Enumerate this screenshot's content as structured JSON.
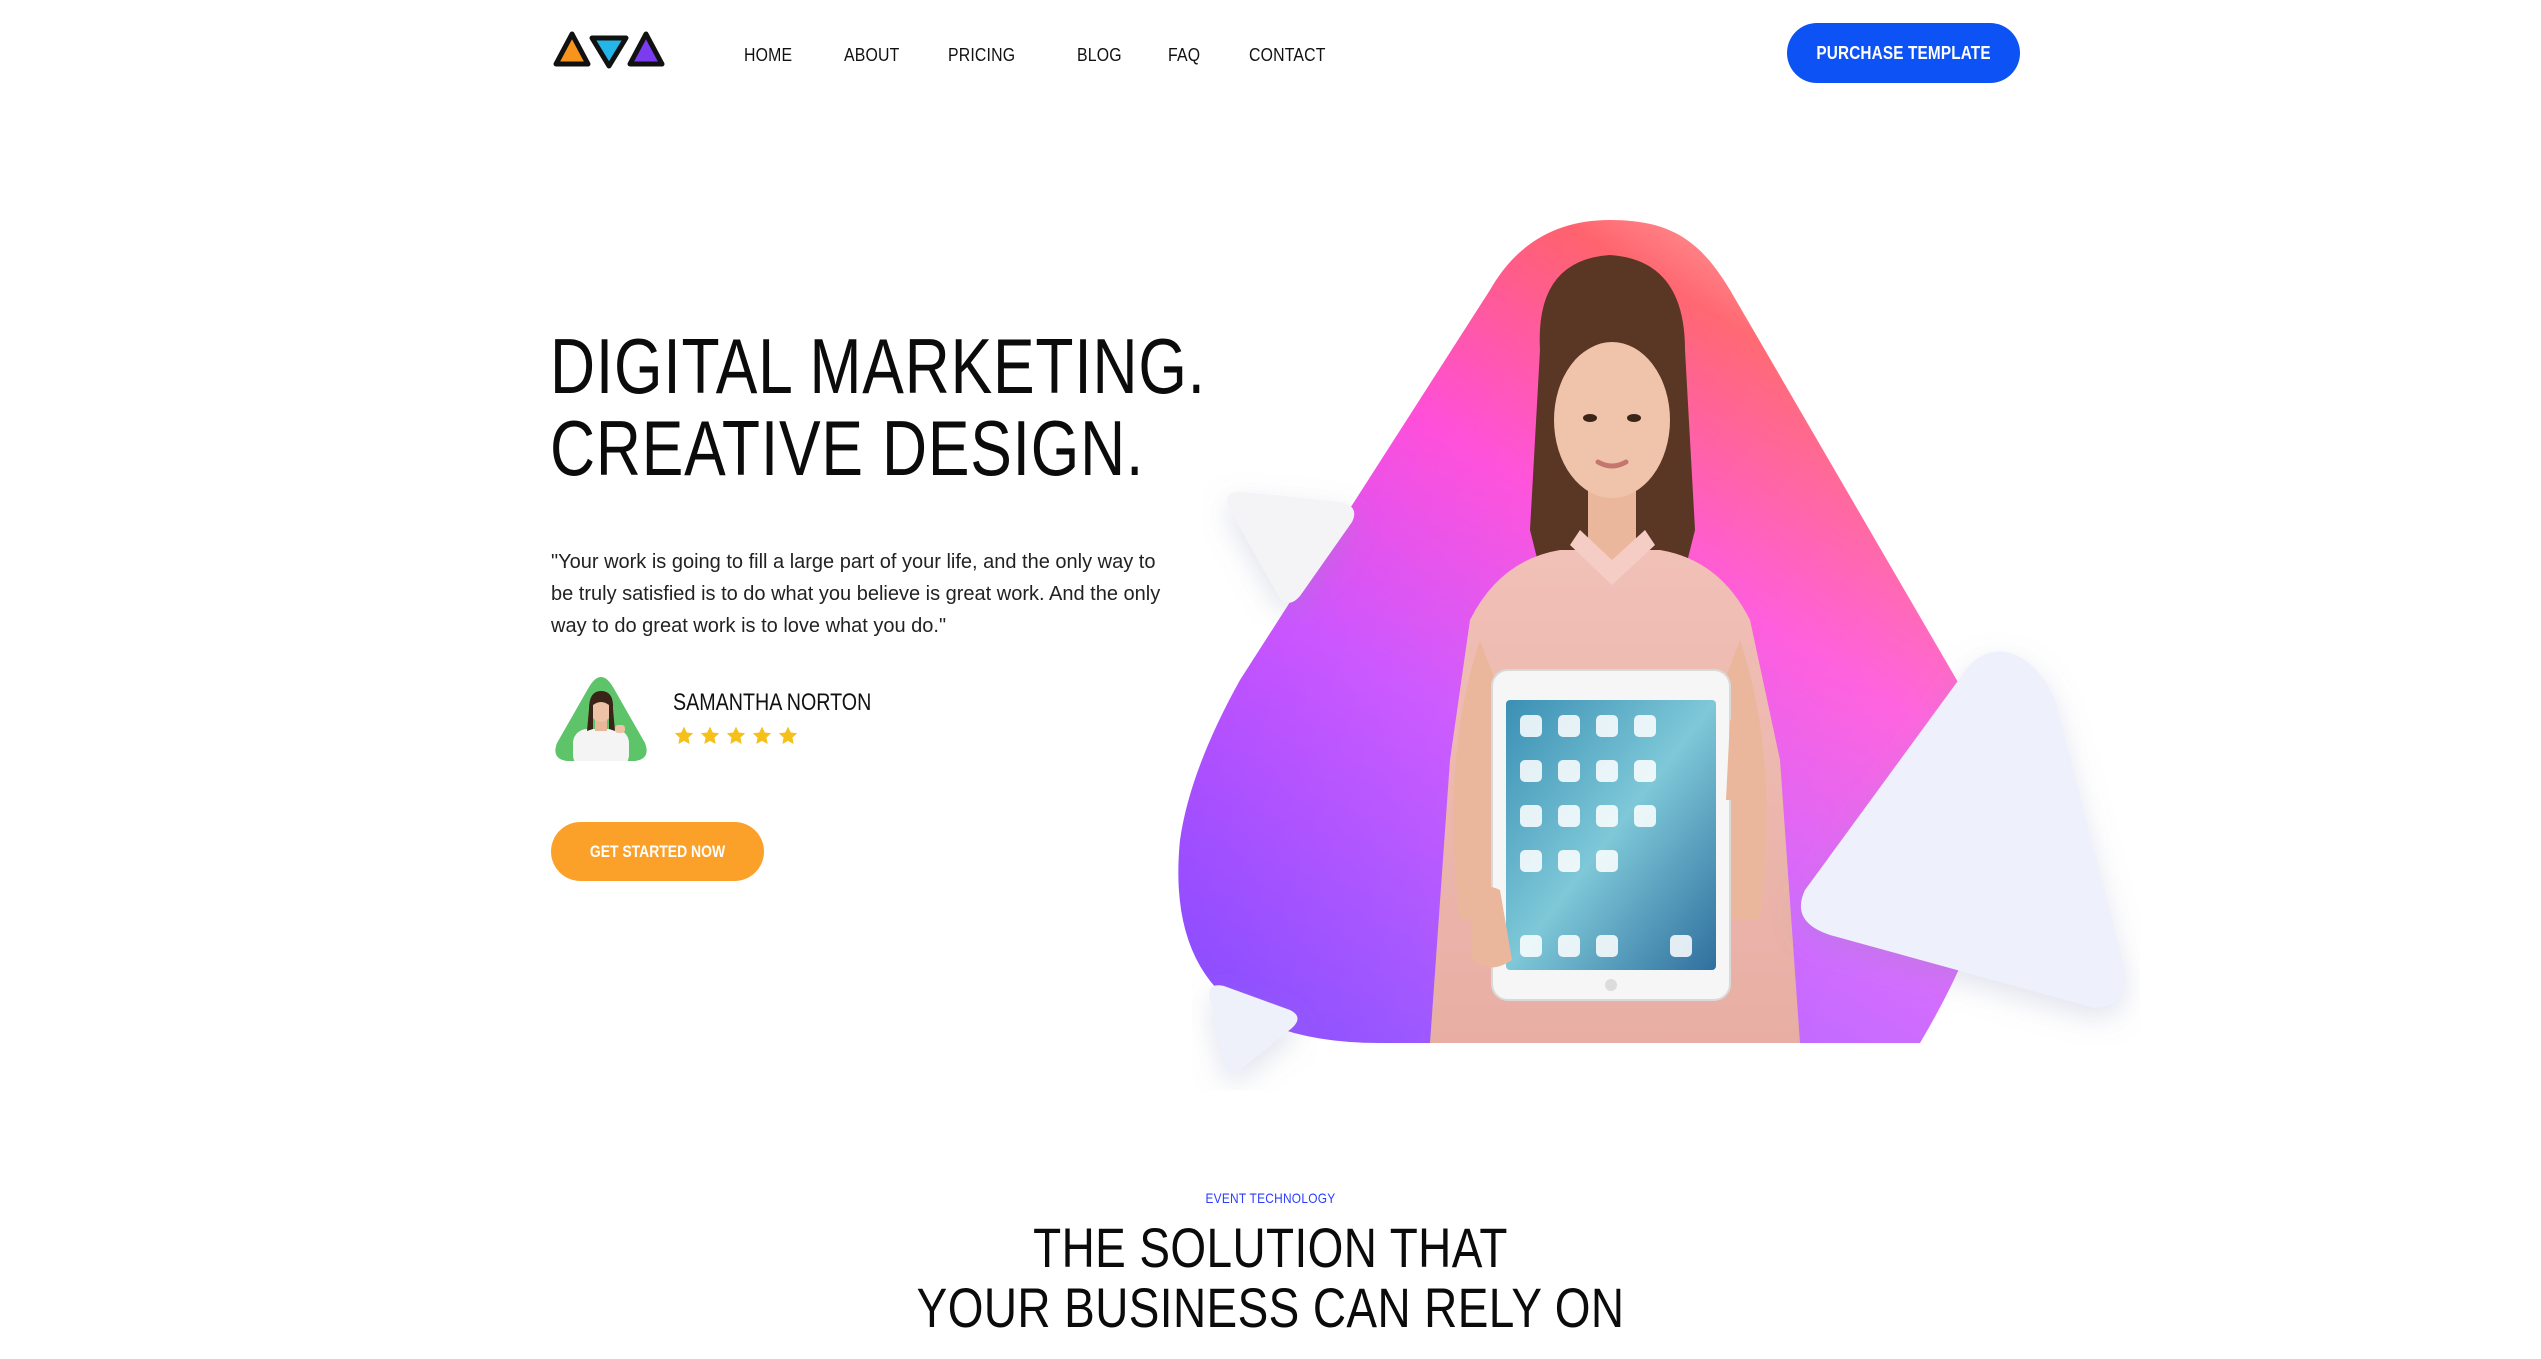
{
  "header": {
    "logo_icon": "triangle-logo-icon",
    "nav": [
      {
        "label": "HOME"
      },
      {
        "label": "ABOUT"
      },
      {
        "label": "PRICING"
      },
      {
        "label": "BLOG"
      },
      {
        "label": "FAQ"
      },
      {
        "label": "CONTACT"
      }
    ],
    "purchase_label": "PURCHASE TEMPLATE"
  },
  "hero": {
    "title_line1": "DIGITAL MARKETING.",
    "title_line2": "CREATIVE DESIGN.",
    "quote": "\"Your work is going to fill a large part of your life, and the only way to be truly satisfied is to do what you believe is great work. And the only way to do great work is to love what you do.\"",
    "author_name": "SAMANTHA NORTON",
    "rating": 5,
    "cta_label": "GET STARTED NOW"
  },
  "section": {
    "eyebrow": "EVENT TECHNOLOGY",
    "title_line1": "THE SOLUTION THAT",
    "title_line2": "YOUR BUSINESS CAN RELY ON"
  },
  "colors": {
    "primary_blue": "#0d52f5",
    "cta_orange": "#fba12a",
    "star_yellow": "#f5c01a",
    "avatar_green": "#5ec46a",
    "eyebrow_blue": "#2a3cff"
  }
}
